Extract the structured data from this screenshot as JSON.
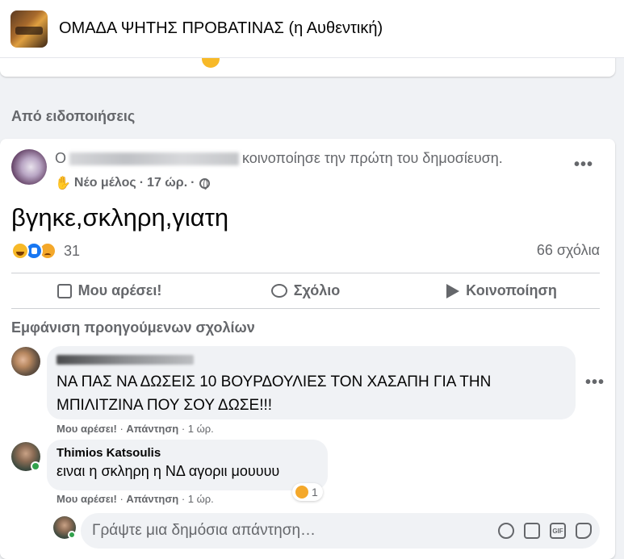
{
  "header": {
    "group_name": "ΟΜΑΔΑ ΨΗΤΗΣ ΠΡΟΒΑΤΙΝΑΣ (η Αυθεντική)"
  },
  "section_label": "Από ειδοποιήσεις",
  "post": {
    "author_prefix": "Ο",
    "author_action": "κοινοποίησε την πρώτη του δημοσίευση.",
    "badge": "Νέο μέλος",
    "time": "17 ώρ.",
    "text": "βγηκε,σκληρη,γιατη",
    "reaction_count": "31",
    "comment_count": "66 σχόλια",
    "more_label": "•••"
  },
  "actions": {
    "like": "Μου αρέσει!",
    "comment": "Σχόλιο",
    "share": "Κοινοποίηση"
  },
  "previous_comments": "Εμφάνιση προηγούμενων σχολίων",
  "comments": [
    {
      "text": "ΝΑ ΠΑΣ ΝΑ ΔΩΣΕΙΣ 10 ΒΟΥΡΔΟΥΛΙΕΣ ΤΟΝ ΧΑΣΑΠΗ ΓΙΑ ΤΗΝ ΜΠΙΛΙΤΖΙΝΑ ΠΟΥ ΣΟΥ ΔΩΣΕ!!!",
      "like": "Μου αρέσει!",
      "reply": "Απάντηση",
      "time": "1 ώρ."
    },
    {
      "name": "Thimios Katsoulis",
      "text": "ειναι η σκληρη η ΝΔ αγοριι μουυυυ",
      "like": "Μου αρέσει!",
      "reply": "Απάντηση",
      "time": "1 ώρ.",
      "reaction_count": "1"
    }
  ],
  "reply_box": {
    "placeholder": "Γράψτε μια δημόσια απάντηση…",
    "gif_label": "GIF"
  },
  "colors": {
    "background": "#f0f2f5",
    "secondary_text": "#65676b",
    "online": "#31a24c",
    "like_blue": "#1877f2"
  }
}
